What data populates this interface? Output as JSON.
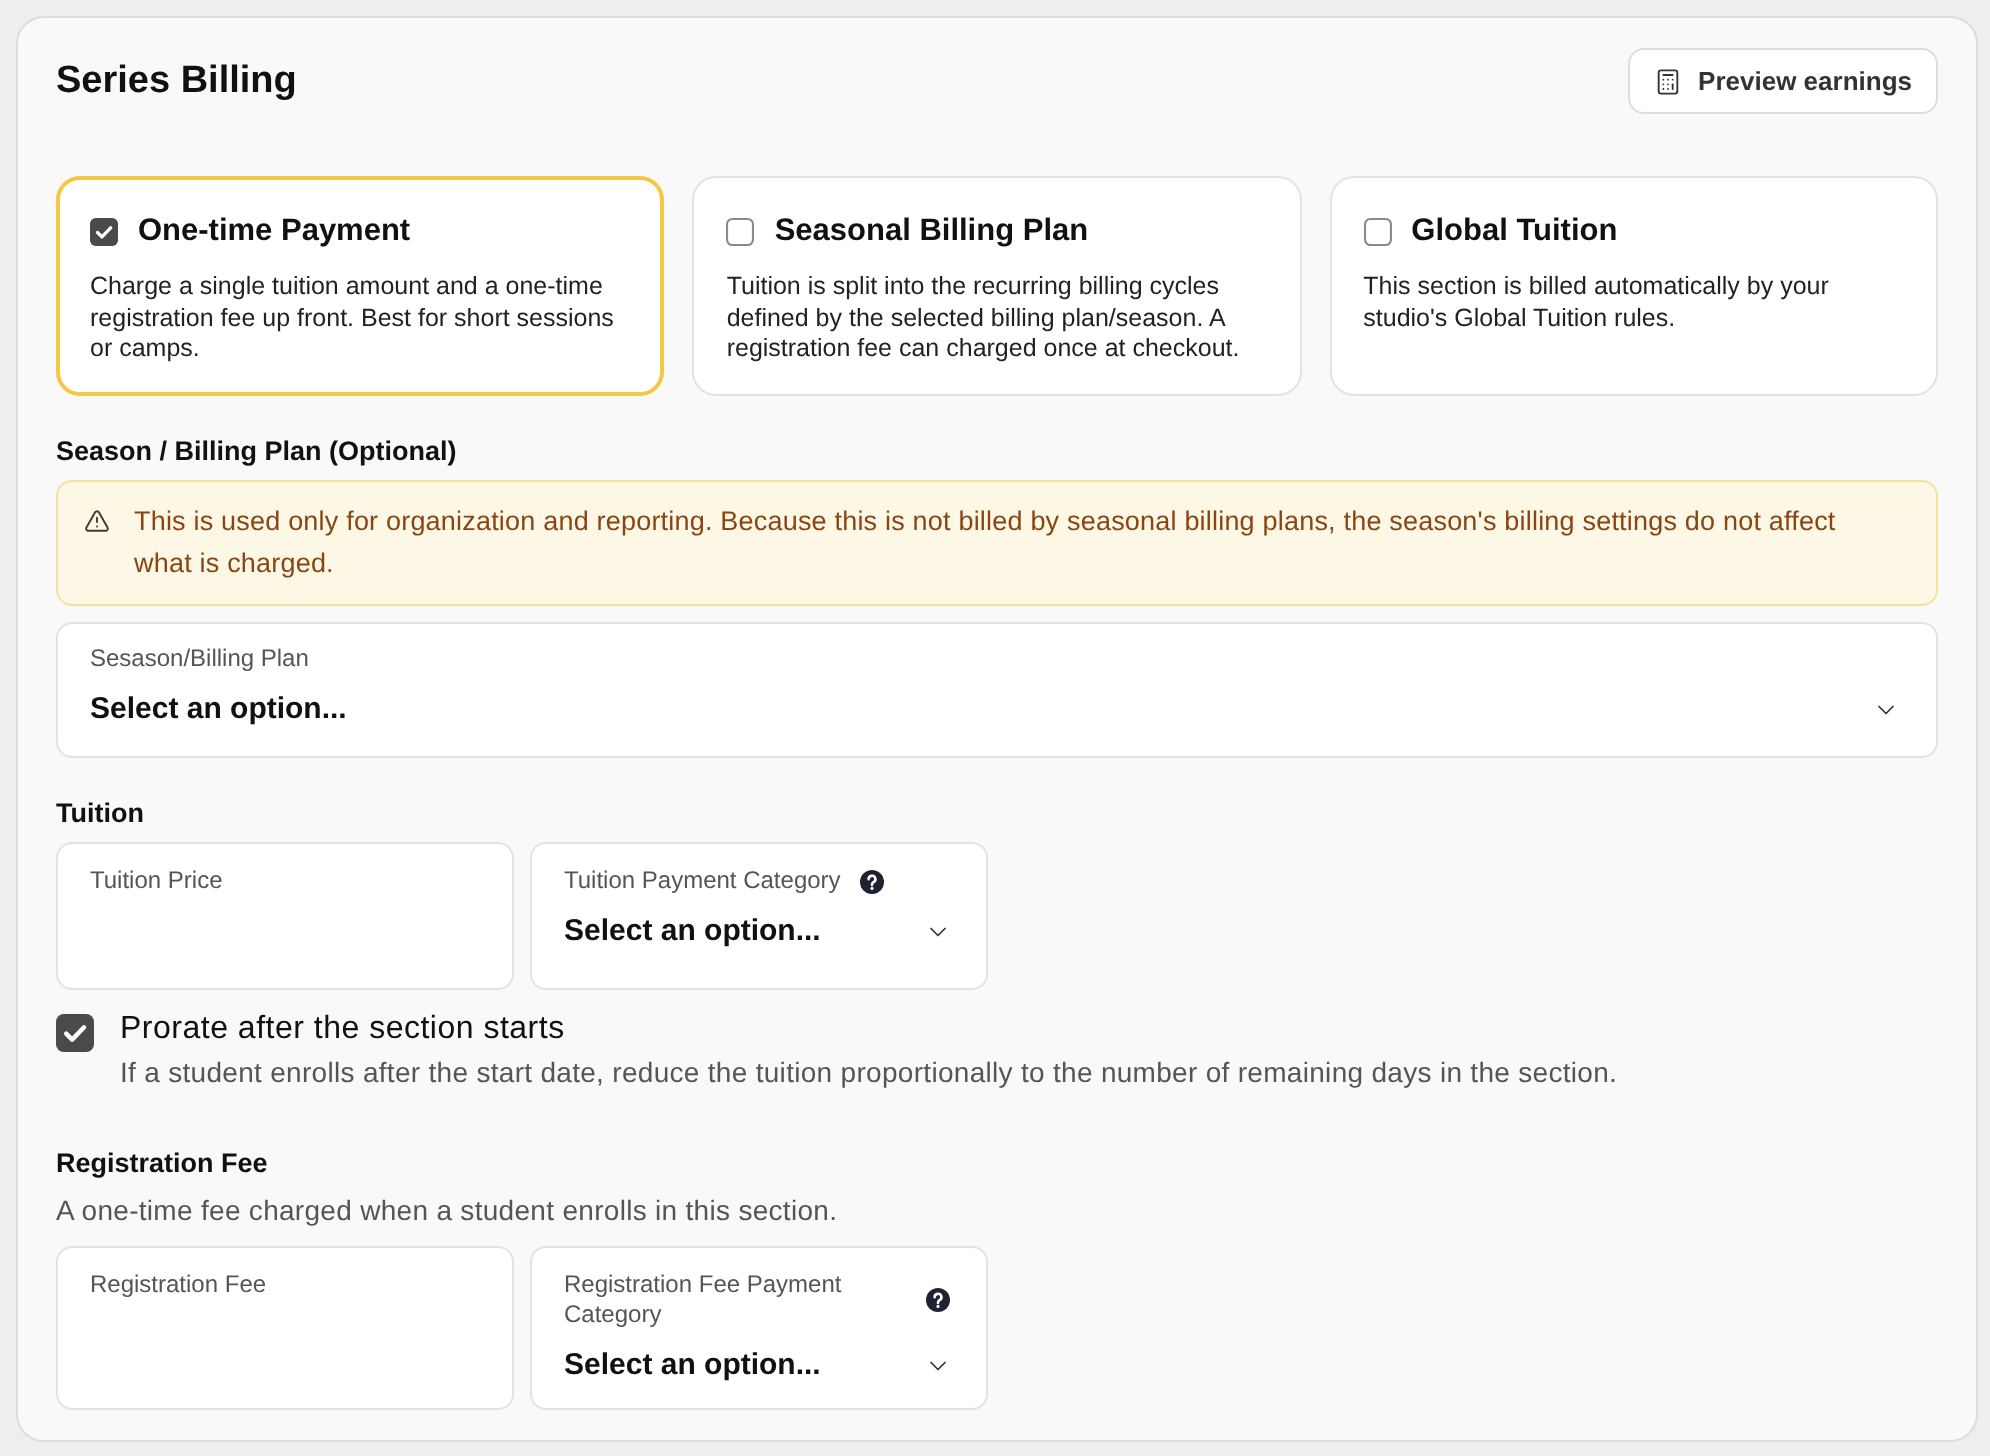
{
  "header": {
    "title": "Series Billing",
    "preview_button": "Preview earnings"
  },
  "billing_options": [
    {
      "title": "One-time Payment",
      "description": "Charge a single tuition amount and a one-time registration fee up front. Best for short sessions or camps.",
      "selected": true
    },
    {
      "title": "Seasonal Billing Plan",
      "description": "Tuition is split into the recurring billing cycles defined by the selected billing plan/season. A registration fee can charged once at checkout.",
      "selected": false
    },
    {
      "title": "Global Tuition",
      "description": "This section is billed automatically by your studio's Global Tuition rules.",
      "selected": false
    }
  ],
  "season_plan": {
    "heading": "Season / Billing Plan (Optional)",
    "alert": "This is used only for organization and reporting. Because this is not billed by seasonal billing plans, the season's billing settings do not affect what is charged.",
    "select": {
      "label": "Sesason/Billing Plan",
      "placeholder": "Select an option..."
    }
  },
  "tuition": {
    "heading": "Tuition",
    "fields": [
      {
        "kind": "input",
        "label": "Tuition Price"
      },
      {
        "kind": "select",
        "label": "Tuition Payment Category",
        "placeholder": "Select an option...",
        "help": true
      }
    ],
    "prorate": {
      "label": "Prorate after the section starts",
      "description": "If a student enrolls after the start date, reduce the tuition proportionally to the number of remaining days in the section.",
      "checked": true
    }
  },
  "registration_fee": {
    "heading": "Registration Fee",
    "description": "A one-time fee charged when a student enrolls in this section.",
    "fields": [
      {
        "kind": "input",
        "label": "Registration Fee"
      },
      {
        "kind": "select",
        "label": "Registration Fee Payment Category",
        "placeholder": "Select an option...",
        "help": true
      }
    ]
  }
}
